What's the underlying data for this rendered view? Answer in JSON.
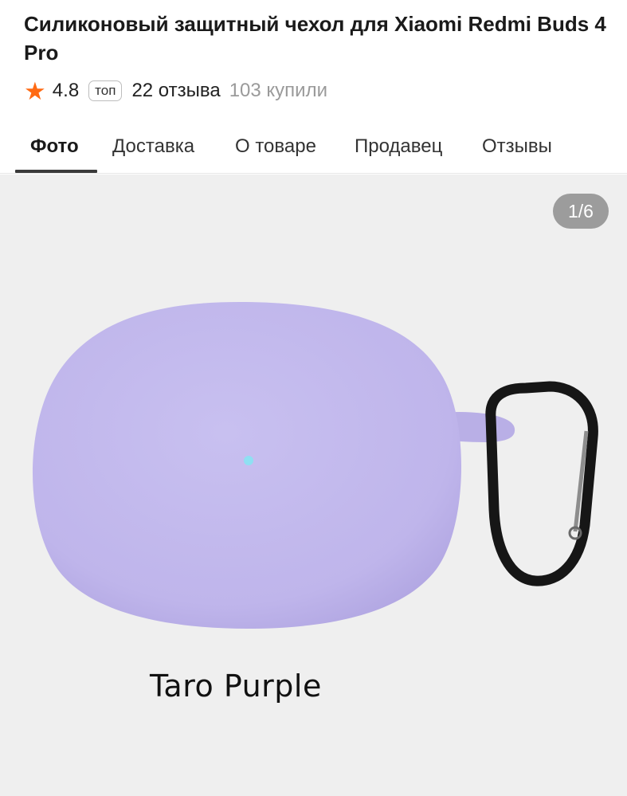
{
  "product": {
    "title": "Силиконовый защитный чехол для Xiaomi Redmi Buds 4 Pro",
    "rating": "4.8",
    "badge": "топ",
    "reviews": "22 отзыва",
    "bought": "103 купили"
  },
  "tabs": [
    {
      "label": "Фото",
      "active": true
    },
    {
      "label": "Доставка"
    },
    {
      "label": "О товаре"
    },
    {
      "label": "Продавец"
    },
    {
      "label": "Отзывы"
    }
  ],
  "gallery": {
    "counter": "1/6",
    "color_label": "Taro Purple",
    "case_color": "#c5bcee",
    "led_color": "#8fe0f2",
    "clip_color": "#161616"
  },
  "icons": {
    "rating": "star-icon"
  },
  "colors": {
    "accent": "#ff6a13",
    "background": "#efefef"
  }
}
